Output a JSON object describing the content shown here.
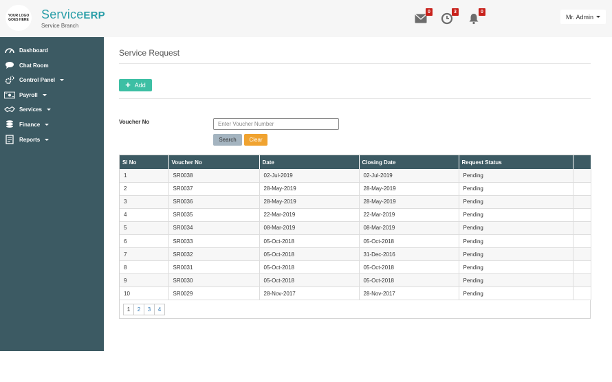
{
  "header": {
    "logo_line1": "YOUR LOGO",
    "logo_line2": "GOES HERE",
    "brand_service": "Service",
    "brand_erp": "ERP",
    "brand_sub": "Service Branch",
    "badges": {
      "mail": "0",
      "clock": "3",
      "bell": "0"
    },
    "user_label": "Mr. Admin"
  },
  "sidebar": {
    "items": [
      {
        "label": "Dashboard",
        "icon": "dashboard-icon",
        "has_caret": false
      },
      {
        "label": "Chat Room",
        "icon": "chat-icon",
        "has_caret": false
      },
      {
        "label": "Control Panel",
        "icon": "gears-icon",
        "has_caret": true
      },
      {
        "label": "Payroll",
        "icon": "cash-icon",
        "has_caret": true
      },
      {
        "label": "Services",
        "icon": "handshake-icon",
        "has_caret": true
      },
      {
        "label": "Finance",
        "icon": "coins-icon",
        "has_caret": true
      },
      {
        "label": "Reports",
        "icon": "report-icon",
        "has_caret": true
      }
    ]
  },
  "main": {
    "title": "Service Request",
    "add_label": "Add",
    "voucher_label": "Voucher No",
    "voucher_placeholder": "Enter Voucher Number",
    "search_label": "Search",
    "clear_label": "Clear"
  },
  "table": {
    "headers": [
      "Sl No",
      "Voucher No",
      "Date",
      "Closing Date",
      "Request Status",
      ""
    ],
    "rows": [
      [
        "1",
        "SR0038",
        "02-Jul-2019",
        "02-Jul-2019",
        "Pending"
      ],
      [
        "2",
        "SR0037",
        "28-May-2019",
        "28-May-2019",
        "Pending"
      ],
      [
        "3",
        "SR0036",
        "28-May-2019",
        "28-May-2019",
        "Pending"
      ],
      [
        "4",
        "SR0035",
        "22-Mar-2019",
        "22-Mar-2019",
        "Pending"
      ],
      [
        "5",
        "SR0034",
        "08-Mar-2019",
        "08-Mar-2019",
        "Pending"
      ],
      [
        "6",
        "SR0033",
        "05-Oct-2018",
        "05-Oct-2018",
        "Pending"
      ],
      [
        "7",
        "SR0032",
        "05-Oct-2018",
        "31-Dec-2016",
        "Pending"
      ],
      [
        "8",
        "SR0031",
        "05-Oct-2018",
        "05-Oct-2018",
        "Pending"
      ],
      [
        "9",
        "SR0030",
        "05-Oct-2018",
        "05-Oct-2018",
        "Pending"
      ],
      [
        "10",
        "SR0029",
        "28-Nov-2017",
        "28-Nov-2017",
        "Pending"
      ]
    ]
  },
  "pagination": {
    "pages": [
      "1",
      "2",
      "3",
      "4"
    ],
    "active": "1"
  },
  "colors": {
    "sidebar": "#3c5a63",
    "accent_teal": "#3dbfa4",
    "brand": "#2a9ea8",
    "clear_orange": "#f0a330",
    "badge_red": "#c8211b"
  }
}
